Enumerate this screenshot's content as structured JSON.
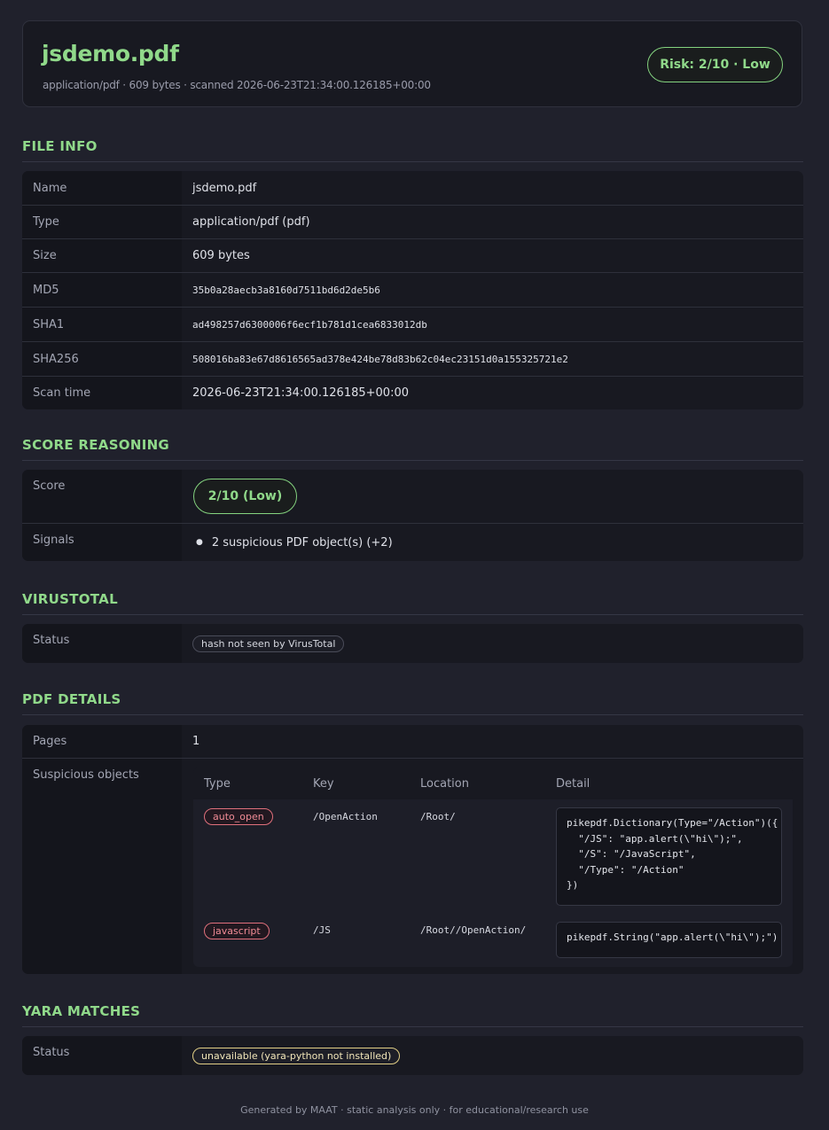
{
  "header": {
    "title": "jsdemo.pdf",
    "meta": "application/pdf · 609 bytes · scanned 2026-06-23T21:34:00.126185+00:00",
    "risk": "Risk: 2/10 · Low"
  },
  "file_info": {
    "title": "FILE INFO",
    "rows": [
      {
        "key": "Name",
        "value": "jsdemo.pdf"
      },
      {
        "key": "Type",
        "value": "application/pdf (pdf)"
      },
      {
        "key": "Size",
        "value": "609 bytes"
      },
      {
        "key": "MD5",
        "value": "35b0a28aecb3a8160d7511bd6d2de5b6"
      },
      {
        "key": "SHA1",
        "value": "ad498257d6300006f6ecf1b781d1cea6833012db"
      },
      {
        "key": "SHA256",
        "value": "508016ba83e67d8616565ad378e424be78d83b62c04ec23151d0a155325721e2"
      },
      {
        "key": "Scan time",
        "value": "2026-06-23T21:34:00.126185+00:00"
      }
    ]
  },
  "score": {
    "title": "SCORE REASONING",
    "score_label": "Score",
    "score_value": "2/10 (Low)",
    "signals_label": "Signals",
    "signals": [
      "2 suspicious PDF object(s) (+2)"
    ]
  },
  "virustotal": {
    "title": "VIRUSTOTAL",
    "status_label": "Status",
    "status": "hash not seen by VirusTotal"
  },
  "pdf": {
    "title": "PDF DETAILS",
    "pages_label": "Pages",
    "pages": "1",
    "susp_label": "Suspicious objects",
    "columns": [
      "Type",
      "Key",
      "Location",
      "Detail"
    ],
    "objects": [
      {
        "type": "auto_open",
        "key": "/OpenAction",
        "location": "/Root/",
        "detail": "pikepdf.Dictionary(Type=\"/Action\")({\n  \"/JS\": \"app.alert(\\\"hi\\\");\",\n  \"/S\": \"/JavaScript\",\n  \"/Type\": \"/Action\"\n})"
      },
      {
        "type": "javascript",
        "key": "/JS",
        "location": "/Root//OpenAction/",
        "detail": "pikepdf.String(\"app.alert(\\\"hi\\\");\")"
      }
    ]
  },
  "yara": {
    "title": "YARA MATCHES",
    "status_label": "Status",
    "status": "unavailable (yara-python not installed)"
  },
  "footer": "Generated by MAAT · static analysis only · for educational/research use",
  "colors": {
    "accent": "#90d98a",
    "background": "#20212c",
    "card": "#181921",
    "danger": "#e0707c",
    "warning": "#e2cf86"
  }
}
